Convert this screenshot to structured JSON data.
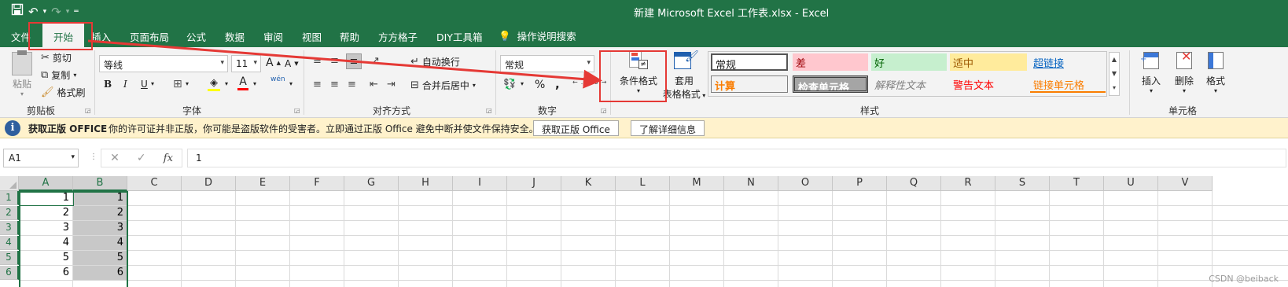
{
  "title_bar": {
    "title": "新建 Microsoft Excel 工作表.xlsx  -  Excel",
    "save_icon": "save-icon",
    "undo_icon": "undo-icon",
    "redo_icon": "redo-icon",
    "customize_icon": "customize-qat-icon"
  },
  "tabs": [
    "文件",
    "开始",
    "插入",
    "页面布局",
    "公式",
    "数据",
    "审阅",
    "视图",
    "帮助",
    "方方格子",
    "DIY工具箱"
  ],
  "active_tab": "开始",
  "tell_me": "操作说明搜索",
  "clipboard": {
    "paste": "粘贴",
    "cut": "剪切",
    "copy": "复制",
    "format_painter": "格式刷",
    "label": "剪贴板"
  },
  "font": {
    "name": "等线",
    "size": "11",
    "bold": "B",
    "italic": "I",
    "underline": "U",
    "label": "字体",
    "increase": "A",
    "decrease": "A",
    "color_letter": "A",
    "phonetic": "wén"
  },
  "alignment": {
    "wrap": "自动换行",
    "merge": "合并后居中",
    "label": "对齐方式"
  },
  "number": {
    "format": "常规",
    "percent": "%",
    "comma": ",",
    "inc_decimal": ".00",
    "dec_decimal": ".00",
    "label": "数字"
  },
  "styles": {
    "conditional_format": "条件格式",
    "table_format_line1": "套用",
    "table_format_line2": "表格格式",
    "label": "样式",
    "cells": [
      {
        "text": "常规",
        "bg": "#ffffff",
        "color": "#000000"
      },
      {
        "text": "差",
        "bg": "#ffc7ce",
        "color": "#9c0006"
      },
      {
        "text": "好",
        "bg": "#c6efce",
        "color": "#006100"
      },
      {
        "text": "适中",
        "bg": "#ffeb9c",
        "color": "#9c5700"
      },
      {
        "text": "超链接",
        "bg": "#f3f3f3",
        "color": "#0563c1"
      },
      {
        "text": "计算",
        "bg": "#f2f2f2",
        "color": "#fa7d00"
      },
      {
        "text": "检查单元格",
        "bg": "#a5a5a5",
        "color": "#ffffff"
      },
      {
        "text": "解释性文本",
        "bg": "#f3f3f3",
        "color": "#7f7f7f"
      },
      {
        "text": "警告文本",
        "bg": "#f3f3f3",
        "color": "#ff0000"
      },
      {
        "text": "链接单元格",
        "bg": "#f3f3f3",
        "color": "#fa7d00"
      }
    ]
  },
  "cells_group": {
    "insert": "插入",
    "delete": "删除",
    "format": "格式",
    "label": "单元格"
  },
  "message_bar": {
    "title": "获取正版 OFFICE",
    "text": "你的许可证并非正版，你可能是盗版软件的受害者。立即通过正版 Office 避免中断并使文件保持安全。",
    "button1": "获取正版 Office",
    "button2": "了解详细信息"
  },
  "formula_bar": {
    "name_box": "A1",
    "cancel": "✕",
    "enter": "✓",
    "fx": "fx",
    "value": "1"
  },
  "columns": [
    "A",
    "B",
    "C",
    "D",
    "E",
    "F",
    "G",
    "H",
    "I",
    "J",
    "K",
    "L",
    "M",
    "N",
    "O",
    "P",
    "Q",
    "R",
    "S",
    "T",
    "U",
    "V"
  ],
  "rows": [
    {
      "num": "1",
      "a": "1",
      "b": "1"
    },
    {
      "num": "2",
      "a": "2",
      "b": "2"
    },
    {
      "num": "3",
      "a": "3",
      "b": "3"
    },
    {
      "num": "4",
      "a": "4",
      "b": "4"
    },
    {
      "num": "5",
      "a": "5",
      "b": "5"
    },
    {
      "num": "6",
      "a": "6",
      "b": "6"
    }
  ],
  "watermark": "CSDN @beiback",
  "colors": {
    "excel_green": "#217346",
    "annotation_red": "#e53935",
    "message_bg": "#fff2cc"
  }
}
